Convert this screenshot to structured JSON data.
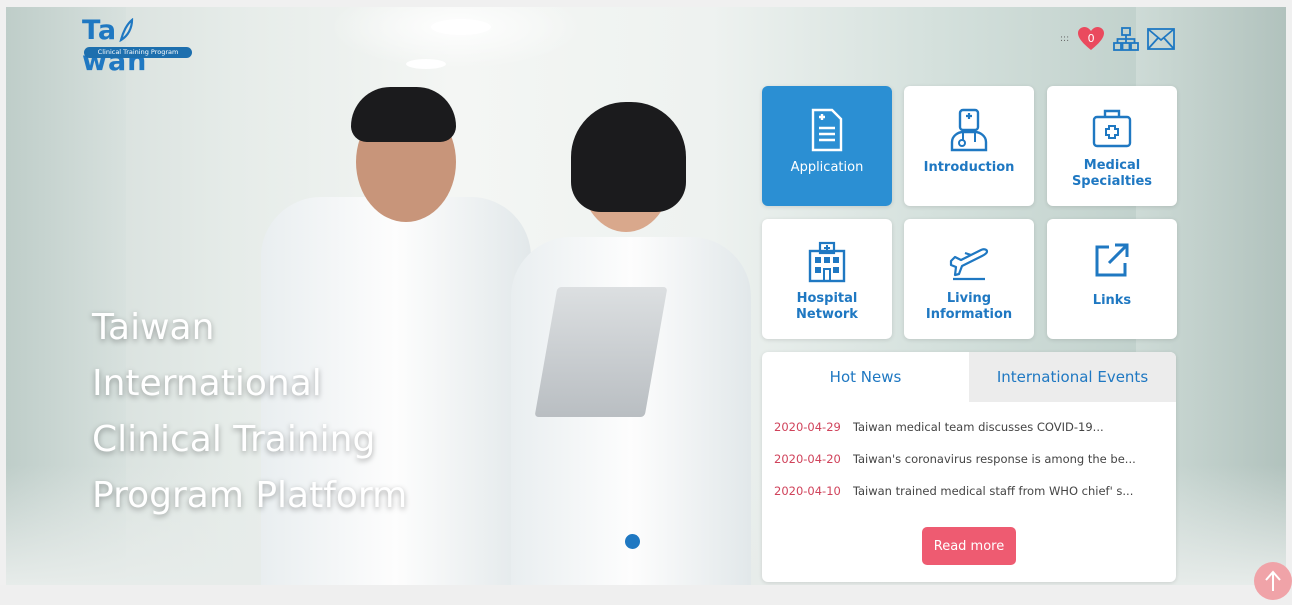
{
  "logo": {
    "word": "Ta wan",
    "tagline": "Clinical Training Program"
  },
  "hero": {
    "title_lines": [
      "Taiwan",
      "International",
      "Clinical Training",
      "Program Platform"
    ]
  },
  "header": {
    "favorites_count": "0"
  },
  "tiles": [
    {
      "label": "Application",
      "icon": "application-document-icon"
    },
    {
      "label": "Introduction",
      "icon": "doctor-icon"
    },
    {
      "label": "Medical\nSpecialties",
      "label_lines": [
        "Medical",
        "Specialties"
      ],
      "icon": "medical-kit-icon"
    },
    {
      "label_lines": [
        "Hospital",
        "Network"
      ],
      "icon": "hospital-icon"
    },
    {
      "label_lines": [
        "Living",
        "Information"
      ],
      "icon": "airplane-icon"
    },
    {
      "label": "Links",
      "icon": "external-link-icon"
    }
  ],
  "news": {
    "tabs": [
      "Hot News",
      "International Events"
    ],
    "items": [
      {
        "date": "2020-04-29",
        "title": "Taiwan medical team discusses COVID-19..."
      },
      {
        "date": "2020-04-20",
        "title": "Taiwan's coronavirus response is among the be..."
      },
      {
        "date": "2020-04-10",
        "title": "Taiwan trained medical staff from WHO chief' s..."
      }
    ],
    "read_more": "Read more"
  },
  "colors": {
    "brand_blue": "#1f78c2",
    "tile_active": "#2b8fd3",
    "news_date": "#d0435b",
    "read_more": "#ee5b71"
  }
}
